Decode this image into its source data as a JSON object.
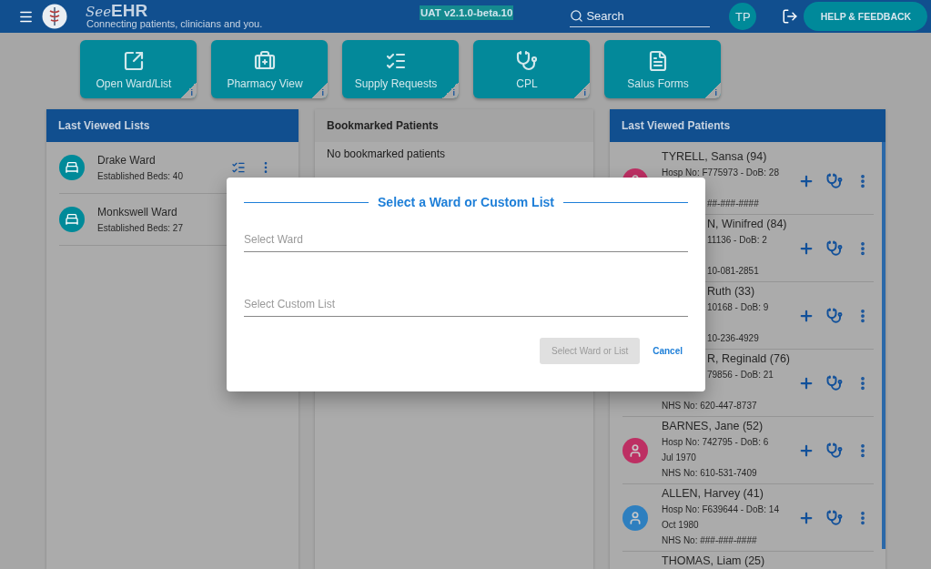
{
  "header": {
    "brand_prefix": "See",
    "brand_suffix": "EHR",
    "tagline": "Connecting patients, clinicians and you.",
    "environment": "UAT v2.1.0-beta.10",
    "search": {
      "placeholder": "Search"
    },
    "user_initials": "TP",
    "help_button": "HELP & FEEDBACK"
  },
  "tiles": [
    {
      "kind": "open",
      "label": "Open Ward/List",
      "info": "i"
    },
    {
      "kind": "pharmacy",
      "label": "Pharmacy View",
      "info": "i"
    },
    {
      "kind": "supply",
      "label": "Supply Requests",
      "info": "i"
    },
    {
      "kind": "cpl",
      "label": "CPL",
      "info": "i"
    },
    {
      "kind": "forms",
      "label": "Salus Forms",
      "info": "i"
    }
  ],
  "last_viewed_lists": {
    "title": "Last Viewed Lists",
    "items": [
      {
        "kind": "with_actions",
        "name": "Drake Ward",
        "beds": "Established Beds: 40"
      },
      {
        "kind": "plain",
        "name": "Monkswell Ward",
        "beds": "Established Beds: 27"
      }
    ]
  },
  "bookmarked": {
    "title": "Bookmarked Patients",
    "empty_text": "No bookmarked patients"
  },
  "last_viewed_patients": {
    "title": "Last Viewed Patients",
    "items": [
      {
        "color": "#bd2f63",
        "lines": [
          {
            "kind": "name",
            "text": "TYRELL, Sansa (94)"
          },
          {
            "kind": "hosp",
            "text": "Hosp No: F775973 - DoB: 28"
          },
          {
            "kind": "nhs_part",
            "text": "##-###-####"
          }
        ]
      },
      {
        "lines": [
          {
            "kind": "name_part",
            "text": "N, Winifred (84)"
          },
          {
            "kind": "hosp_part",
            "text": "11136 - DoB: 2"
          },
          {
            "kind": "nhs_part",
            "text": "10-081-2851"
          }
        ]
      },
      {
        "lines": [
          {
            "kind": "name_part",
            "text": "Ruth (33)"
          },
          {
            "kind": "hosp_part",
            "text": "10168 - DoB: 9"
          },
          {
            "kind": "nhs_part",
            "text": "10-236-4929"
          }
        ]
      },
      {
        "lines": [
          {
            "kind": "name_part",
            "text": "R, Reginald (76)"
          },
          {
            "kind": "hosp_part",
            "text": "79856 - DoB: 21"
          },
          {
            "kind": "nhs",
            "text": "NHS No: 620-447-8737"
          }
        ]
      },
      {
        "color": "#bd2f63",
        "lines": [
          {
            "kind": "name",
            "text": "BARNES, Jane (52)"
          },
          {
            "kind": "hosp",
            "text": "Hosp No: 742795 - DoB: 6"
          },
          {
            "kind": "dob",
            "text": "Jul 1970"
          },
          {
            "kind": "nhs",
            "text": "NHS No: 610-531-7409"
          }
        ]
      },
      {
        "color": "#2e7fbf",
        "lines": [
          {
            "kind": "name",
            "text": "ALLEN, Harvey (41)"
          },
          {
            "kind": "hosp",
            "text": "Hosp No: F639644 - DoB: 14"
          },
          {
            "kind": "dob",
            "text": "Oct 1980"
          },
          {
            "kind": "nhs",
            "text": "NHS No: ###-###-####"
          }
        ]
      },
      {
        "lines": [
          {
            "kind": "name",
            "text": "THOMAS, Liam (25)"
          }
        ]
      }
    ]
  },
  "dialog": {
    "title": "Select a Ward or Custom List",
    "fields": [
      {
        "placeholder": "Select Ward"
      },
      {
        "placeholder": "Select Custom List"
      }
    ],
    "confirm": {
      "label": "Select Ward or List",
      "disabled": true
    },
    "cancel": "Cancel"
  }
}
